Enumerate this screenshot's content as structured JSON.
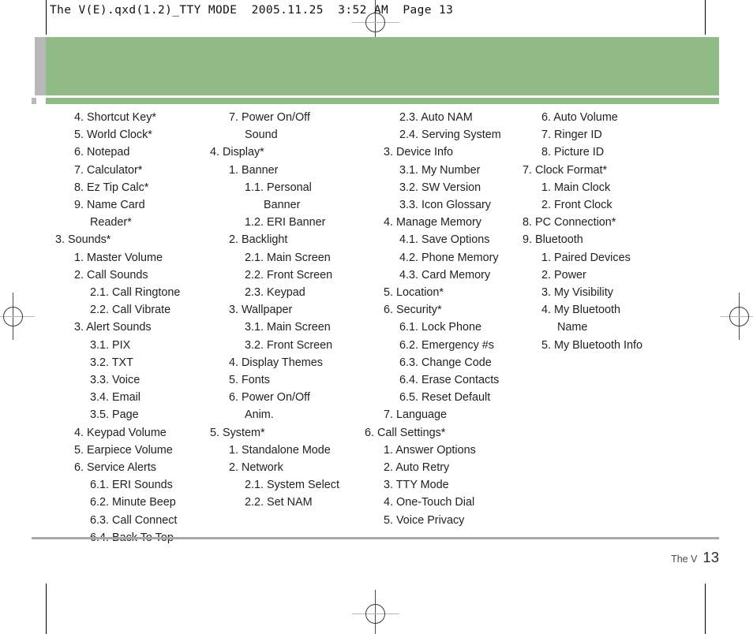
{
  "page": {
    "slug": "The V(E).qxd(1.2)_TTY MODE  2005.11.25  3:52 AM  Page 13",
    "banner_color": "#90bb86",
    "tab_color": "#b8b8b8",
    "rule_color": "#a8a8a8"
  },
  "footer": {
    "label": "The V",
    "page_number": "13"
  },
  "columns": [
    {
      "name": "column-1",
      "entries": [
        {
          "text": "4. Shortcut Key*",
          "level": 2
        },
        {
          "text": "5. World Clock*",
          "level": 2
        },
        {
          "text": "6. Notepad",
          "level": 2
        },
        {
          "text": "7. Calculator*",
          "level": 2
        },
        {
          "text": "8. Ez Tip Calc*",
          "level": 2
        },
        {
          "text": "9. Name Card",
          "level": 2
        },
        {
          "text": "Reader*",
          "level": 3
        },
        {
          "text": "3. Sounds*",
          "level": 1
        },
        {
          "text": "1. Master Volume",
          "level": 2
        },
        {
          "text": "2. Call Sounds",
          "level": 2
        },
        {
          "text": "2.1. Call Ringtone",
          "level": 3
        },
        {
          "text": "2.2. Call Vibrate",
          "level": 3
        },
        {
          "text": "3. Alert Sounds",
          "level": 2
        },
        {
          "text": "3.1. PIX",
          "level": 3
        },
        {
          "text": "3.2. TXT",
          "level": 3
        },
        {
          "text": "3.3. Voice",
          "level": 3
        },
        {
          "text": "3.4. Email",
          "level": 3
        },
        {
          "text": "3.5. Page",
          "level": 3
        },
        {
          "text": "4. Keypad Volume",
          "level": 2
        },
        {
          "text": "5. Earpiece Volume",
          "level": 2
        },
        {
          "text": "6. Service Alerts",
          "level": 2
        },
        {
          "text": "6.1. ERI Sounds",
          "level": 3
        },
        {
          "text": "6.2. Minute Beep",
          "level": 3
        },
        {
          "text": "6.3. Call Connect",
          "level": 3
        },
        {
          "text": "6.4. Back To Top",
          "level": 3
        }
      ]
    },
    {
      "name": "column-2",
      "entries": [
        {
          "text": "7. Power On/Off",
          "level": 2
        },
        {
          "text": "Sound",
          "level": 3
        },
        {
          "text": "4. Display*",
          "level": 1
        },
        {
          "text": "1. Banner",
          "level": 2
        },
        {
          "text": "1.1. Personal",
          "level": 3
        },
        {
          "text": "Banner",
          "level": 4
        },
        {
          "text": "1.2. ERI Banner",
          "level": 3
        },
        {
          "text": "2. Backlight",
          "level": 2
        },
        {
          "text": "2.1. Main Screen",
          "level": 3
        },
        {
          "text": "2.2. Front Screen",
          "level": 3
        },
        {
          "text": "2.3. Keypad",
          "level": 3
        },
        {
          "text": "3. Wallpaper",
          "level": 2
        },
        {
          "text": "3.1. Main Screen",
          "level": 3
        },
        {
          "text": "3.2. Front Screen",
          "level": 3
        },
        {
          "text": "4. Display Themes",
          "level": 2
        },
        {
          "text": "5. Fonts",
          "level": 2
        },
        {
          "text": "6. Power On/Off",
          "level": 2
        },
        {
          "text": "Anim.",
          "level": 3
        },
        {
          "text": "5. System*",
          "level": 1
        },
        {
          "text": "1. Standalone Mode",
          "level": 2
        },
        {
          "text": "2. Network",
          "level": 2
        },
        {
          "text": "2.1. System Select",
          "level": 3
        },
        {
          "text": "2.2. Set NAM",
          "level": 3
        }
      ]
    },
    {
      "name": "column-3",
      "entries": [
        {
          "text": "2.3. Auto NAM",
          "level": 3
        },
        {
          "text": "2.4. Serving System",
          "level": 3
        },
        {
          "text": "3. Device Info",
          "level": 2
        },
        {
          "text": "3.1. My Number",
          "level": 3
        },
        {
          "text": "3.2. SW Version",
          "level": 3
        },
        {
          "text": "3.3. Icon Glossary",
          "level": 3
        },
        {
          "text": "4. Manage Memory",
          "level": 2
        },
        {
          "text": "4.1. Save Options",
          "level": 3
        },
        {
          "text": "4.2. Phone Memory",
          "level": 3
        },
        {
          "text": "4.3. Card Memory",
          "level": 3
        },
        {
          "text": "5. Location*",
          "level": 2
        },
        {
          "text": "6. Security*",
          "level": 2
        },
        {
          "text": "6.1. Lock Phone",
          "level": 3
        },
        {
          "text": "6.2. Emergency #s",
          "level": 3
        },
        {
          "text": "6.3. Change Code",
          "level": 3
        },
        {
          "text": "6.4. Erase Contacts",
          "level": 3
        },
        {
          "text": "6.5. Reset Default",
          "level": 3
        },
        {
          "text": "7. Language",
          "level": 2
        },
        {
          "text": "6. Call Settings*",
          "level": 1
        },
        {
          "text": "1. Answer Options",
          "level": 2
        },
        {
          "text": "2. Auto Retry",
          "level": 2
        },
        {
          "text": "3. TTY Mode",
          "level": 2
        },
        {
          "text": "4. One-Touch Dial",
          "level": 2
        },
        {
          "text": "5. Voice Privacy",
          "level": 2
        }
      ]
    },
    {
      "name": "column-4",
      "entries": [
        {
          "text": "6. Auto Volume",
          "level": 2
        },
        {
          "text": "7. Ringer ID",
          "level": 2
        },
        {
          "text": "8. Picture ID",
          "level": 2
        },
        {
          "text": "7. Clock Format*",
          "level": 1
        },
        {
          "text": "1. Main Clock",
          "level": 2
        },
        {
          "text": "2. Front Clock",
          "level": 2
        },
        {
          "text": "8. PC Connection*",
          "level": 1
        },
        {
          "text": "9. Bluetooth",
          "level": 1
        },
        {
          "text": "1. Paired Devices",
          "level": 2
        },
        {
          "text": "2. Power",
          "level": 2
        },
        {
          "text": "3. My Visibility",
          "level": 2
        },
        {
          "text": "4. My Bluetooth",
          "level": 2
        },
        {
          "text": "Name",
          "level": 3
        },
        {
          "text": "5. My Bluetooth Info",
          "level": 2
        }
      ]
    }
  ]
}
